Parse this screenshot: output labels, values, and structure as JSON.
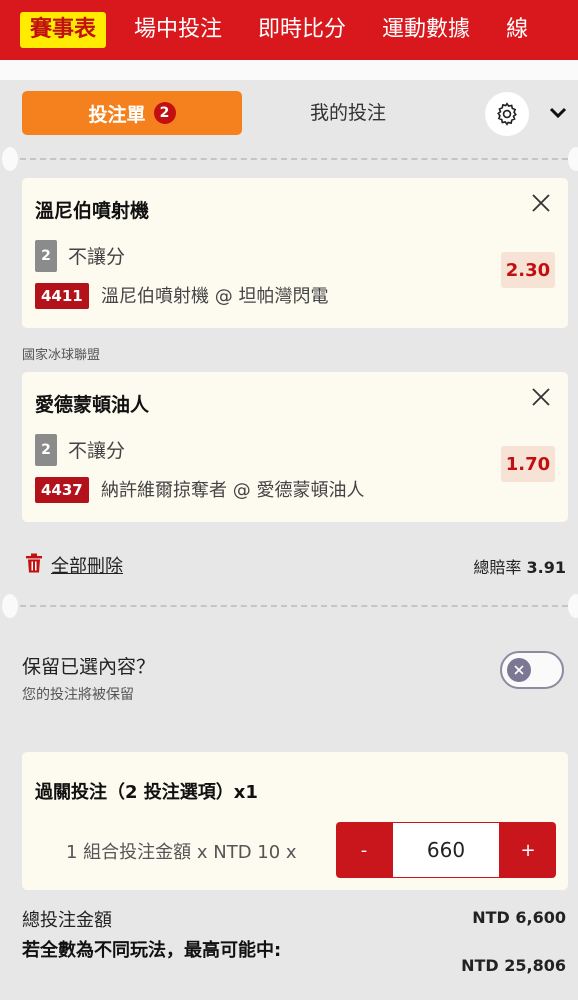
{
  "nav": {
    "tabs": [
      "賽事表",
      "場中投注",
      "即時比分",
      "運動數據",
      "線"
    ]
  },
  "slip": {
    "betslip_label": "投注單",
    "betslip_count": "2",
    "mybets_label": "我的投注"
  },
  "selections": [
    {
      "team": "溫尼伯噴射機",
      "leg": "2",
      "market": "不讓分",
      "odds": "2.30",
      "code": "4411",
      "match": "溫尼伯噴射機 @ 坦帕灣閃電"
    },
    {
      "league": "國家冰球聯盟",
      "team": "愛德蒙頓油人",
      "leg": "2",
      "market": "不讓分",
      "odds": "1.70",
      "code": "4437",
      "match": "納許維爾掠奪者 @ 愛德蒙頓油人"
    }
  ],
  "actions": {
    "delete_all": "全部刪除",
    "total_odds_label": "總賠率",
    "total_odds_value": "3.91"
  },
  "keep": {
    "title": "保留已選內容？",
    "subtitle": "您的投注將被保留"
  },
  "parlay": {
    "title": "過關投注（2 投注選項）x1",
    "unit_text": "1 組合投注金額 x NTD 10 x",
    "minus": "-",
    "plus": "+",
    "amount": "660"
  },
  "summary": {
    "total_stake_label": "總投注金額",
    "total_stake_value": "NTD 6,600",
    "max_win_label": "若全數為不同玩法，最高可能中:",
    "max_win_value": "NTD 25,806"
  },
  "colors": {
    "brand_red": "#d8181c",
    "active_tab_yellow": "#ffec00",
    "betslip_orange": "#f4801e"
  }
}
